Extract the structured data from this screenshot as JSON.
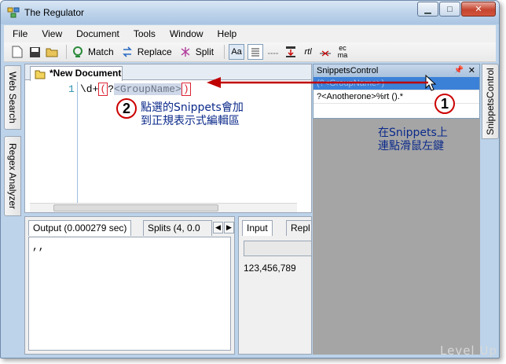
{
  "window": {
    "title": "The Regulator"
  },
  "menu": [
    "File",
    "View",
    "Document",
    "Tools",
    "Window",
    "Help"
  ],
  "toolbar": {
    "match_label": "Match",
    "replace_label": "Replace",
    "split_label": "Split",
    "case_label": "Aa",
    "ecma_label": "ec ma"
  },
  "left_tabs": [
    "Web Search",
    "Regex Analyzer"
  ],
  "document": {
    "tab_title": "*New Document",
    "line_number": "1",
    "code_prefix": "\\d+",
    "code_open": "(",
    "code_q": "?",
    "code_group": "<GroupName>",
    "code_close": ")"
  },
  "output": {
    "tab_output": "Output (0.000279 sec)",
    "tab_splits": "Splits (4, 0.0",
    "content": ",,"
  },
  "input": {
    "tab_input": "Input",
    "tab_replace": "Repl",
    "content": "123,456,789"
  },
  "snippets": {
    "title": "SnippetsControl",
    "items": [
      "(?<GroupName>)",
      "?<Anotherone>%rt ().*"
    ],
    "selected_index": 0
  },
  "right_tab": "SnippetsControl",
  "annotations": {
    "step1_number": "1",
    "step1_text": "在Snippets上\n連點滑鼠左鍵",
    "step2_number": "2",
    "step2_text": "點選的Snippets會加\n到正規表示式編輯區"
  },
  "watermark": "Level Up",
  "colors": {
    "arrow": "#c00000",
    "selection": "#3c81d8",
    "annotation_text": "#0b2a8a"
  }
}
